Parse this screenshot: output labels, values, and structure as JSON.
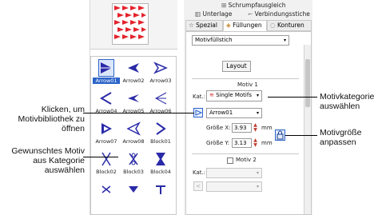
{
  "annotations": {
    "motif_category": "Motivkategorie\nauswählen",
    "motif_size": "Motivgröße\nanpassen",
    "click_library": "Klicken, um\nMotivbibliothek zu\nöffnen",
    "desired_motif": "Gewunschtes Motiv\naus Kategorie\nauswählen"
  },
  "header": {
    "shrink_comp": "Schrumpfausgleich",
    "underlay": "Unterlage",
    "connecting_stitches": "Verbindungsstiche",
    "tabs": [
      "Spezial",
      "Füllungen",
      "Konturen"
    ]
  },
  "fill": {
    "type_value": "Motivfüllstich",
    "layout_button": "Layout",
    "motif1_title": "Motiv 1",
    "cat_label": "Kat.:",
    "cat_value": "Single Motifs",
    "motif_value": "Arrow01",
    "size_x_label": "Größe X:",
    "size_x_value": "3.93",
    "size_y_label": "Größe Y:",
    "size_y_value": "3.13",
    "unit": "mm",
    "motif2_title": "Motiv 2",
    "cat2_label": "Kat.:"
  },
  "motifs": [
    {
      "label": "Arrow01",
      "selected": true
    },
    {
      "label": "Arrow02"
    },
    {
      "label": "Arrow03"
    },
    {
      "label": "Arrow04"
    },
    {
      "label": "Arrow05"
    },
    {
      "label": "Arrow06"
    },
    {
      "label": "Arrow07"
    },
    {
      "label": "Arrow08"
    },
    {
      "label": "Block01"
    },
    {
      "label": "Block02"
    },
    {
      "label": "Block03"
    },
    {
      "label": "Block04"
    }
  ],
  "colors": {
    "accent": "#2b63c8",
    "motif": "#2a2aa8",
    "preview": "#e3232c"
  }
}
